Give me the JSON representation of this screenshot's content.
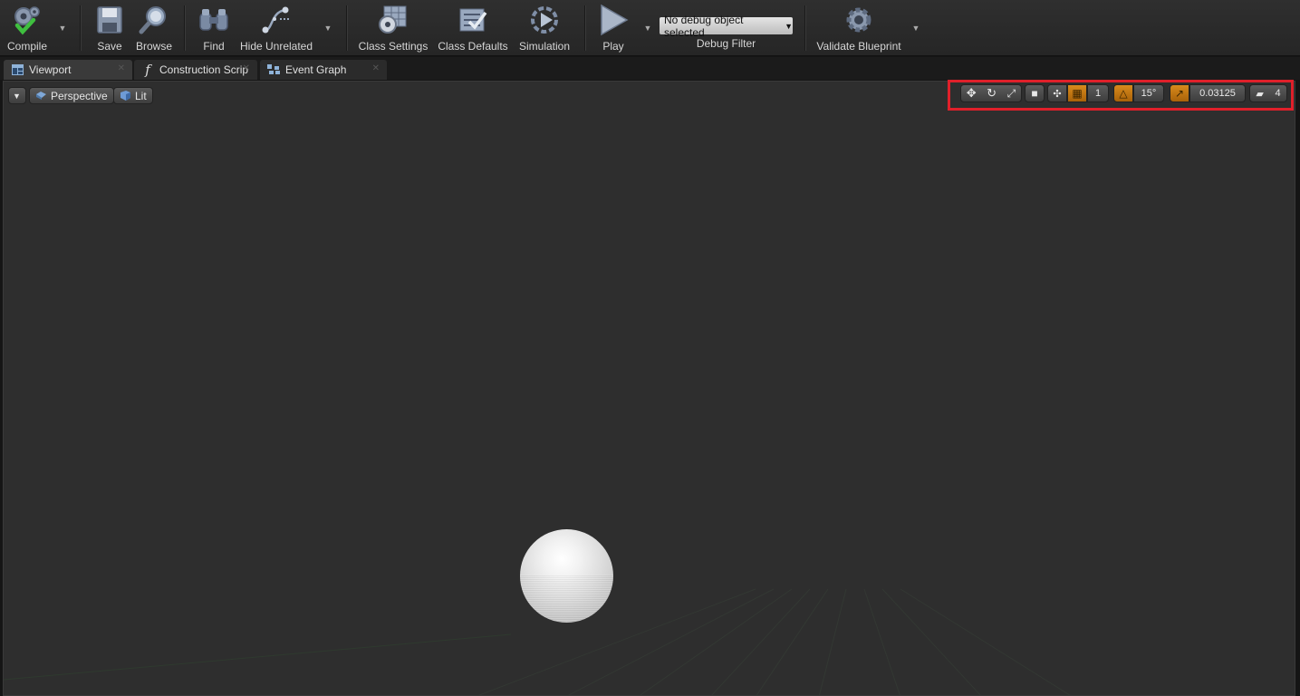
{
  "toolbar": {
    "compile": "Compile",
    "save": "Save",
    "browse": "Browse",
    "find": "Find",
    "hide_unrelated": "Hide Unrelated",
    "class_settings": "Class Settings",
    "class_defaults": "Class Defaults",
    "simulation": "Simulation",
    "play": "Play",
    "debug_object": "No debug object selected",
    "debug_filter": "Debug Filter",
    "validate": "Validate Blueprint"
  },
  "tabs": [
    {
      "label": "Viewport"
    },
    {
      "label": "Construction Scrip"
    },
    {
      "label": "Event Graph"
    }
  ],
  "viewport": {
    "view_mode": "Perspective",
    "lighting": "Lit",
    "grid_snap_value": "1",
    "rotation_snap_value": "15°",
    "scale_snap_value": "0.03125",
    "camera_speed": "4"
  },
  "colors": {
    "highlight": "#e0202a",
    "accent_orange": "#c97a14",
    "viewport_bg": "#2e2e2e"
  }
}
